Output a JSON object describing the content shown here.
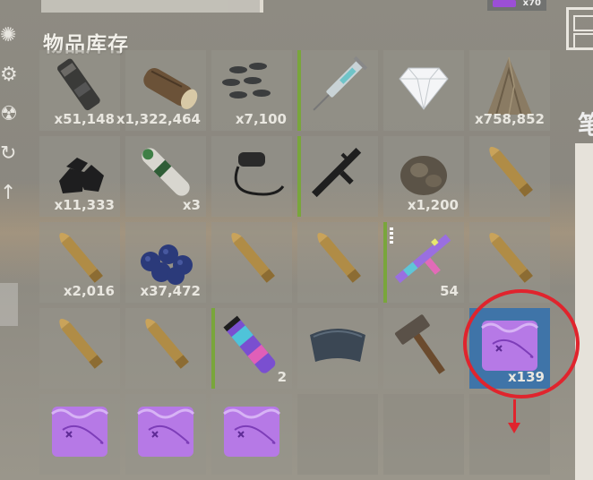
{
  "inventory": {
    "title": "物品库存",
    "top_item_qty": "x70",
    "right_panel_glyph": "笔",
    "selected_color": "#3f74a8",
    "highlight_color": "#e0242d",
    "slots": [
      {
        "icon": "binoculars-icon",
        "qty": "x51,148",
        "bar": false
      },
      {
        "icon": "wood-log-icon",
        "qty": "x1,322,464",
        "bar": false
      },
      {
        "icon": "metal-fragments-icon",
        "qty": "x7,100",
        "bar": false
      },
      {
        "icon": "syringe-icon",
        "qty": "",
        "bar": true
      },
      {
        "icon": "diamond-icon",
        "qty": "",
        "bar": false
      },
      {
        "icon": "cloth-icon",
        "qty": "x758,852",
        "bar": false
      },
      {
        "icon": "coal-icon",
        "qty": "x11,333",
        "bar": false
      },
      {
        "icon": "rocket-icon",
        "qty": "x3",
        "bar": false
      },
      {
        "icon": "sling-strap-icon",
        "qty": "",
        "bar": false
      },
      {
        "icon": "rifle-icon",
        "qty": "",
        "bar": true
      },
      {
        "icon": "ore-bag-icon",
        "qty": "x1,200",
        "bar": false
      },
      {
        "icon": "bullet-icon",
        "qty": "",
        "bar": false
      },
      {
        "icon": "bullet-icon",
        "qty": "x2,016",
        "bar": false
      },
      {
        "icon": "blueberries-icon",
        "qty": "x37,472",
        "bar": false
      },
      {
        "icon": "bullet-icon",
        "qty": "",
        "bar": false
      },
      {
        "icon": "bullet-icon",
        "qty": "",
        "bar": false
      },
      {
        "icon": "holo-rifle-icon",
        "qty": "54",
        "bar": true,
        "dots": true
      },
      {
        "icon": "bullet-icon",
        "qty": "",
        "bar": false
      },
      {
        "icon": "bullet-icon",
        "qty": "",
        "bar": false
      },
      {
        "icon": "bullet-icon",
        "qty": "",
        "bar": false
      },
      {
        "icon": "holo-tube-icon",
        "qty": "2",
        "bar": true
      },
      {
        "icon": "armor-plate-icon",
        "qty": "",
        "bar": false
      },
      {
        "icon": "hammer-icon",
        "qty": "",
        "bar": false
      },
      {
        "icon": "map-icon",
        "qty": "x139",
        "bar": false,
        "selected": true
      },
      {
        "icon": "map-icon",
        "qty": "",
        "bar": false
      },
      {
        "icon": "map-icon",
        "qty": "",
        "bar": false
      },
      {
        "icon": "map-icon",
        "qty": "",
        "bar": false
      },
      {
        "icon": "",
        "qty": "",
        "bar": false
      },
      {
        "icon": "",
        "qty": "",
        "bar": false
      },
      {
        "icon": "",
        "qty": "",
        "bar": false
      }
    ]
  }
}
